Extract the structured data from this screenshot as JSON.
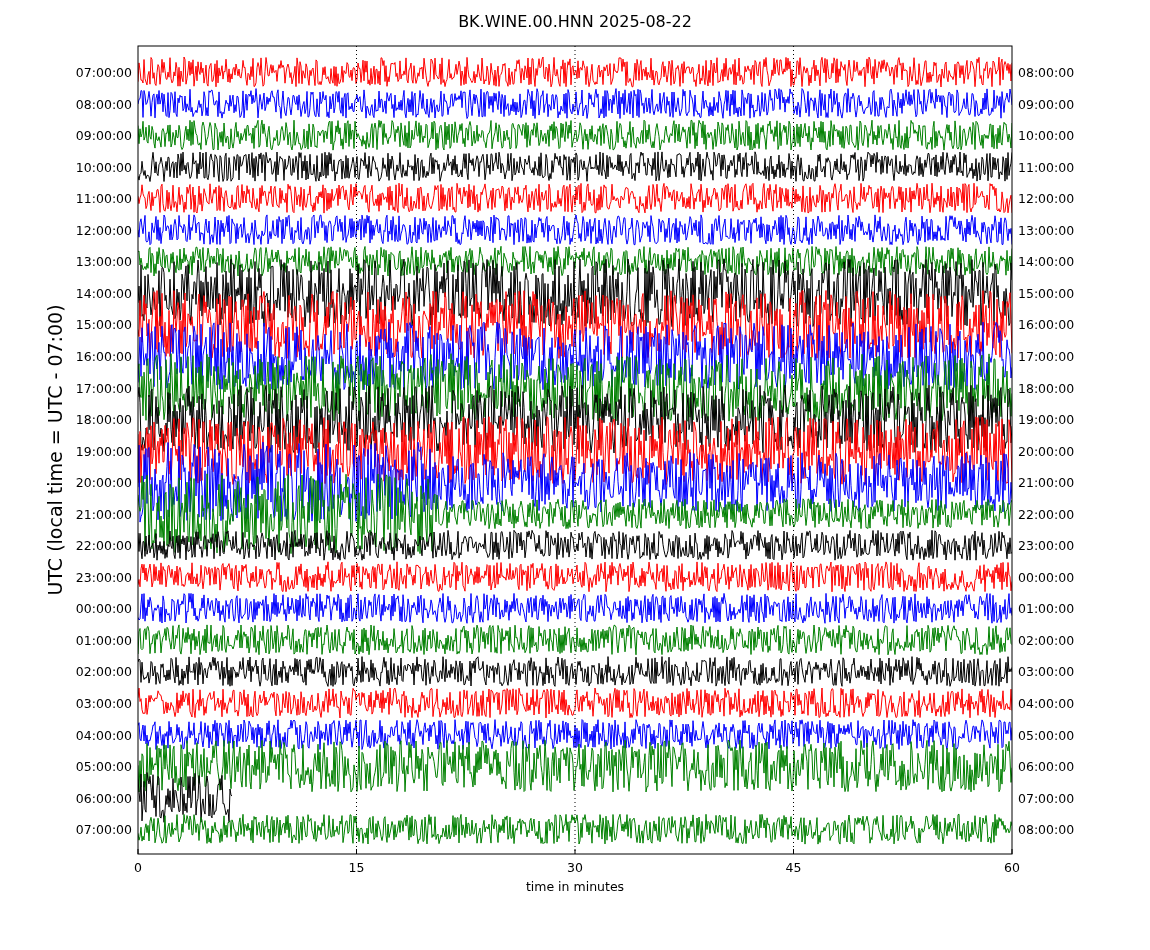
{
  "title": "BK.WINE.00.HNN 2025-08-22",
  "ylabel": "UTC (local time = UTC - 07:00)",
  "xlabel": "time in minutes",
  "xticks": [
    "0",
    "15",
    "30",
    "45",
    "60"
  ],
  "rows": [
    {
      "left": "07:00:00",
      "right": "08:00:00",
      "color": "#ff0000"
    },
    {
      "left": "08:00:00",
      "right": "09:00:00",
      "color": "#0000ff"
    },
    {
      "left": "09:00:00",
      "right": "10:00:00",
      "color": "#008000"
    },
    {
      "left": "10:00:00",
      "right": "11:00:00",
      "color": "#000000"
    },
    {
      "left": "11:00:00",
      "right": "12:00:00",
      "color": "#ff0000"
    },
    {
      "left": "12:00:00",
      "right": "13:00:00",
      "color": "#0000ff"
    },
    {
      "left": "13:00:00",
      "right": "14:00:00",
      "color": "#008000"
    },
    {
      "left": "14:00:00",
      "right": "15:00:00",
      "color": "#000000"
    },
    {
      "left": "15:00:00",
      "right": "16:00:00",
      "color": "#ff0000"
    },
    {
      "left": "16:00:00",
      "right": "17:00:00",
      "color": "#0000ff"
    },
    {
      "left": "17:00:00",
      "right": "18:00:00",
      "color": "#008000"
    },
    {
      "left": "18:00:00",
      "right": "19:00:00",
      "color": "#000000"
    },
    {
      "left": "19:00:00",
      "right": "20:00:00",
      "color": "#ff0000"
    },
    {
      "left": "20:00:00",
      "right": "21:00:00",
      "color": "#0000ff"
    },
    {
      "left": "21:00:00",
      "right": "22:00:00",
      "color": "#008000"
    },
    {
      "left": "22:00:00",
      "right": "23:00:00",
      "color": "#000000"
    },
    {
      "left": "23:00:00",
      "right": "00:00:00",
      "color": "#ff0000"
    },
    {
      "left": "00:00:00",
      "right": "01:00:00",
      "color": "#0000ff"
    },
    {
      "left": "01:00:00",
      "right": "02:00:00",
      "color": "#008000"
    },
    {
      "left": "02:00:00",
      "right": "03:00:00",
      "color": "#000000"
    },
    {
      "left": "03:00:00",
      "right": "04:00:00",
      "color": "#ff0000"
    },
    {
      "left": "04:00:00",
      "right": "05:00:00",
      "color": "#0000ff"
    },
    {
      "left": "05:00:00",
      "right": "06:00:00",
      "color": "#008000"
    },
    {
      "left": "06:00:00",
      "right": "07:00:00",
      "color": "#000000"
    },
    {
      "left": "07:00:00",
      "right": "08:00:00",
      "color": "#008000"
    }
  ]
}
